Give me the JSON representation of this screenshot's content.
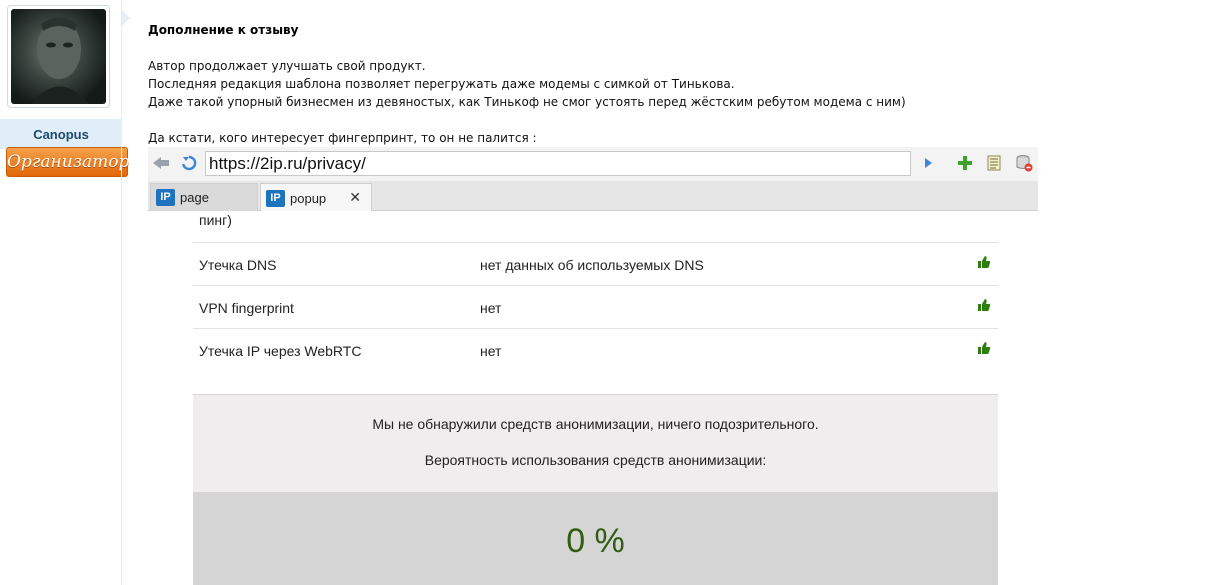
{
  "user": {
    "name": "Canopus",
    "badge": "Организатор"
  },
  "post": {
    "title": "Дополнение к отзыву",
    "lines": [
      "Автор продолжает улучшать свой продукт.",
      "Последняя редакция шаблона позволяет перегружать даже модемы с симкой от Тинькова.",
      "Даже такой упорный бизнесмен из девяностых, как Тинькоф не смог устоять перед жёстским ребутом модема с ним)",
      "Да кстати, кого интересует фингерпринт, то он не палится :"
    ]
  },
  "browser": {
    "url": "https://2ip.ru/privacy/",
    "tabs": [
      {
        "logo": "IP",
        "label": "page"
      },
      {
        "logo": "IP",
        "label": "popup",
        "close": "✕"
      }
    ],
    "icons": [
      "back-arrow-icon",
      "reload-icon",
      "go-arrow-icon",
      "add-plus-icon",
      "page-list-icon",
      "database-remove-icon"
    ]
  },
  "privacy": {
    "truncated_text": "пинг)",
    "rows": [
      {
        "label": "Утечка DNS",
        "value": "нет данных об используемых DNS",
        "icon": "thumbs-up-icon"
      },
      {
        "label": "VPN fingerprint",
        "value": "нет",
        "icon": "thumbs-up-icon"
      },
      {
        "label": "Утечка IP через WebRTC",
        "value": "нет",
        "icon": "thumbs-up-icon"
      }
    ],
    "result_message": "Мы не обнаружили средств анонимизации, ничего подозрительного.",
    "probability_label": "Вероятность использования средств анонимизации:",
    "probability": "0 %",
    "colors": {
      "percent": "#2f5d12",
      "thumb": "#2e7d0f",
      "badge": "#e8740f",
      "link_blue": "#1e73be"
    }
  }
}
